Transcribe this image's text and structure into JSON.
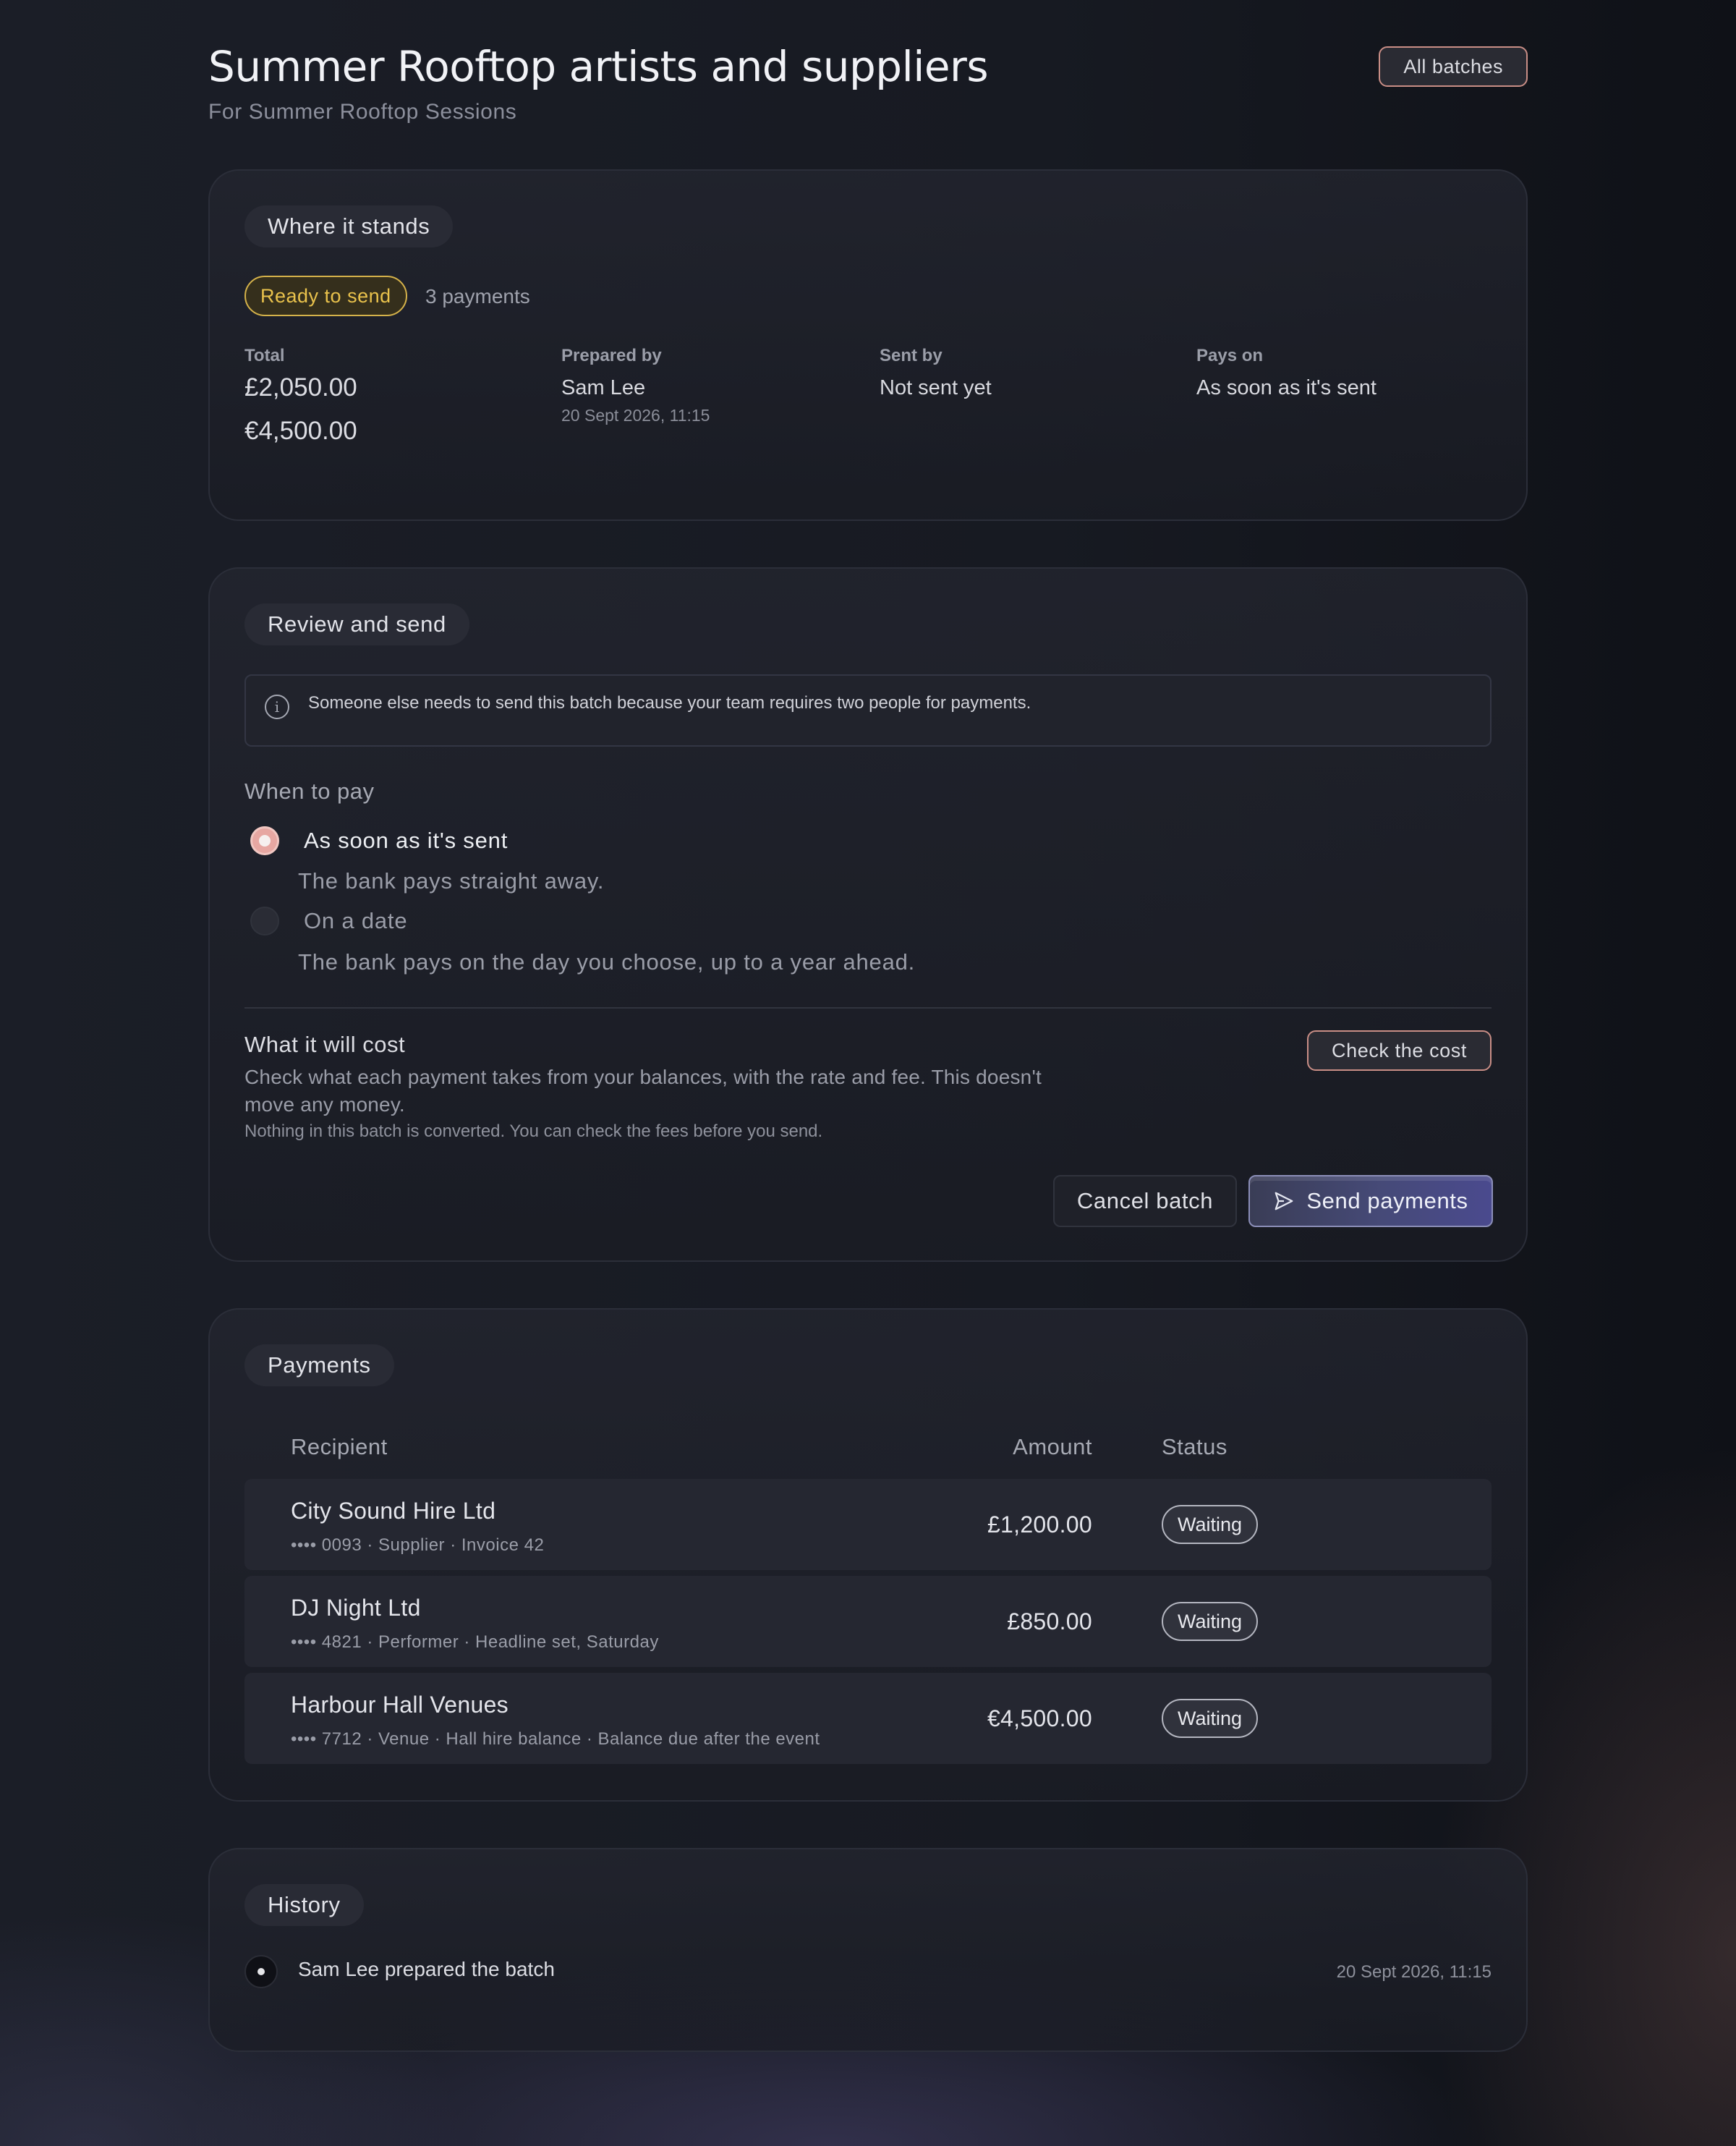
{
  "header": {
    "title": "Summer Rooftop artists and suppliers",
    "subtitle": "For Summer Rooftop Sessions",
    "all_batches_label": "All batches"
  },
  "status_card": {
    "title": "Where it stands",
    "badge": "Ready to send",
    "badge_color": "#e9c24c",
    "count": "3 payments",
    "total_label": "Total",
    "totals": [
      "£2,050.00",
      "€4,500.00"
    ],
    "prepared_by_label": "Prepared by",
    "prepared_by": "Sam Lee",
    "prepared_at": "20 Sept 2026, 11:15",
    "sent_by_label": "Sent by",
    "sent_by": "Not sent yet",
    "pays_on_label": "Pays on",
    "pays_on": "As soon as it's sent"
  },
  "review_card": {
    "title": "Review and send",
    "info_icon": "info-icon",
    "info_text": "Someone else needs to send this batch because your team requires two people for payments.",
    "when_label": "When to pay",
    "options": [
      {
        "label": "As soon as it's sent",
        "description": "The bank pays straight away.",
        "selected": true
      },
      {
        "label": "On a date",
        "description": "The bank pays on the day you choose, up to a year ahead.",
        "selected": false
      }
    ],
    "cost_title": "What it will cost",
    "cost_description": "Check what each payment takes from your balances, with the rate and fee. This doesn't move any money.",
    "cost_note": "Nothing in this batch is converted. You can check the fees before you send.",
    "check_cost_label": "Check the cost",
    "cancel_label": "Cancel batch",
    "send_label": "Send payments",
    "send_icon": "send-icon",
    "accent_color": "#c98e86"
  },
  "payments_card": {
    "title": "Payments",
    "columns": {
      "recipient": "Recipient",
      "amount": "Amount",
      "status": "Status"
    },
    "rows": [
      {
        "name": "City Sound Hire Ltd",
        "meta": "•••• 0093 · Supplier · Invoice 42",
        "amount": "£1,200.00",
        "status": "Waiting"
      },
      {
        "name": "DJ Night Ltd",
        "meta": "•••• 4821 · Performer · Headline set, Saturday",
        "amount": "£850.00",
        "status": "Waiting"
      },
      {
        "name": "Harbour Hall Venues",
        "meta": "•••• 7712 · Venue · Hall hire balance · Balance due after the event",
        "amount": "€4,500.00",
        "status": "Waiting"
      }
    ]
  },
  "history_card": {
    "title": "History",
    "events": [
      {
        "text": "Sam Lee prepared the batch",
        "time": "20 Sept 2026, 11:15"
      }
    ]
  }
}
